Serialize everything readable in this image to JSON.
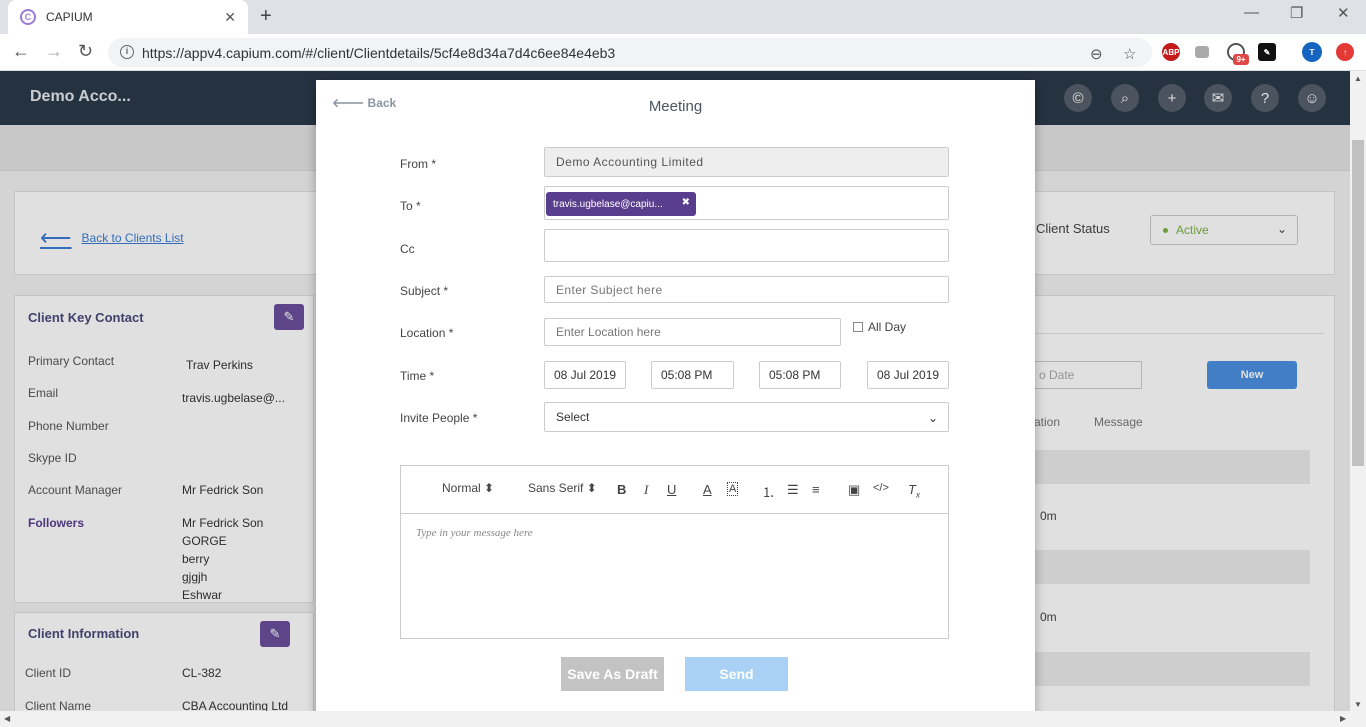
{
  "browser": {
    "tab_title": "CAPIUM",
    "url": "https://appv4.capium.com/#/client/Clientdetails/5cf4e8d34a7d4c6ee84e4eb3",
    "ext_badge": "9+",
    "profile_initial": "T",
    "abp_label": "ABP"
  },
  "app": {
    "title": "Demo Acco...",
    "back_to_clients": "Back to Clients List",
    "client_status_label": "Client Status",
    "client_status_value": "Active",
    "key_contact": {
      "title": "Client Key Contact",
      "primary_contact_label": "Primary Contact",
      "primary_contact_value": "Trav Perkins",
      "email_label": "Email",
      "email_value": "travis.ugbelase@...",
      "phone_label": "Phone Number",
      "skype_label": "Skype ID",
      "account_manager_label": "Account Manager",
      "account_manager_value": "Mr Fedrick Son",
      "followers_label": "Followers",
      "followers": [
        "Mr Fedrick Son",
        "GORGE",
        "berry",
        "gjgjh",
        "Eshwar"
      ]
    },
    "client_info": {
      "title": "Client Information",
      "client_id_label": "Client ID",
      "client_id_value": "CL-382",
      "client_name_label": "Client Name",
      "client_name_value": "CBA Accounting Ltd"
    },
    "right_panel": {
      "to_date_placeholder": "o Date",
      "new_button": "New",
      "col_duration": "ration",
      "col_message": "Message",
      "row_values": [
        "0m",
        "0m"
      ]
    }
  },
  "modal": {
    "back_label": "Back",
    "title": "Meeting",
    "from_label": "From *",
    "from_value": "Demo Accounting Limited",
    "to_label": "To *",
    "to_chip": "travis.ugbelase@capiu...",
    "cc_label": "Cc",
    "subject_label": "Subject *",
    "subject_placeholder": "Enter Subject here",
    "location_label": "Location *",
    "location_placeholder": "Enter Location here",
    "all_day_label": "All Day",
    "time_label": "Time *",
    "start_date": "08 Jul 2019",
    "start_time": "05:08 PM",
    "end_time": "05:08 PM",
    "end_date": "08 Jul 2019",
    "invite_label": "Invite People *",
    "invite_value": "Select",
    "editor": {
      "format_select": "Normal",
      "font_select": "Sans Serif",
      "placeholder": "Type in your message here"
    },
    "draft_button": "Save As Draft",
    "send_button": "Send"
  }
}
